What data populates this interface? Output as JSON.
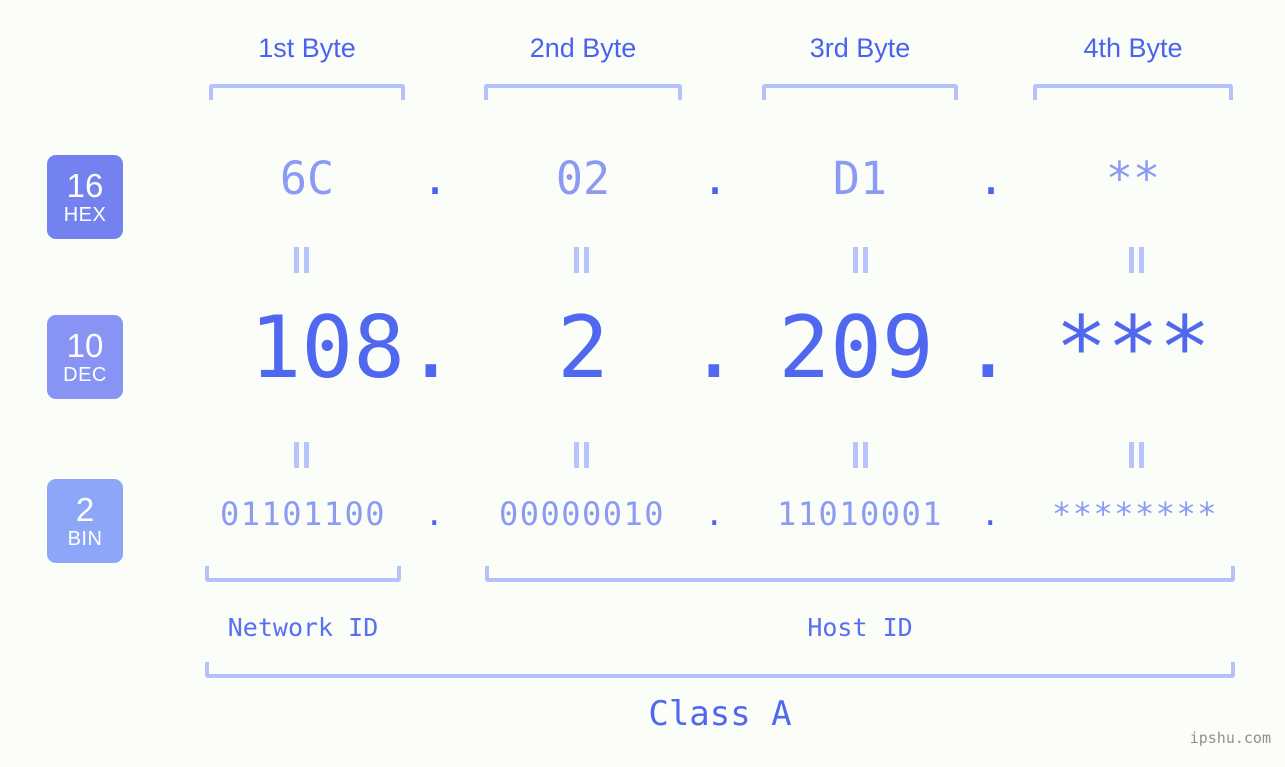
{
  "background_color": "#fbfdf9",
  "accent_colors": {
    "header_blue": "#4a63ef",
    "light_blue": "#8b9bf4",
    "bracket_blue": "#b6c0fb",
    "badge_hex": "#7382ee",
    "badge_dec": "#8894f3",
    "badge_bin": "#8ea6f7",
    "watermark_gray": "#8f8f8f"
  },
  "headers": [
    {
      "label": "1st Byte"
    },
    {
      "label": "2nd Byte"
    },
    {
      "label": "3rd Byte"
    },
    {
      "label": "4th Byte"
    }
  ],
  "bases": [
    {
      "number": "16",
      "name": "HEX"
    },
    {
      "number": "10",
      "name": "DEC"
    },
    {
      "number": "2",
      "name": "BIN"
    }
  ],
  "rows": {
    "hex": {
      "base_number": "16",
      "base_name": "HEX",
      "values": [
        "6C",
        "02",
        "D1",
        "**"
      ],
      "separators": [
        ".",
        ".",
        "."
      ]
    },
    "dec": {
      "base_number": "10",
      "base_name": "DEC",
      "values": [
        "108",
        "2",
        "209",
        "***"
      ],
      "separators": [
        ".",
        ".",
        "."
      ]
    },
    "bin": {
      "base_number": "2",
      "base_name": "BIN",
      "values": [
        "01101100",
        "00000010",
        "11010001",
        "********"
      ],
      "separators": [
        ".",
        ".",
        "."
      ]
    }
  },
  "equality_symbol": "||",
  "regions": [
    {
      "label": "Network ID"
    },
    {
      "label": "Host ID"
    }
  ],
  "class": {
    "label": "Class A"
  },
  "watermark": {
    "text": "ipshu.com"
  }
}
